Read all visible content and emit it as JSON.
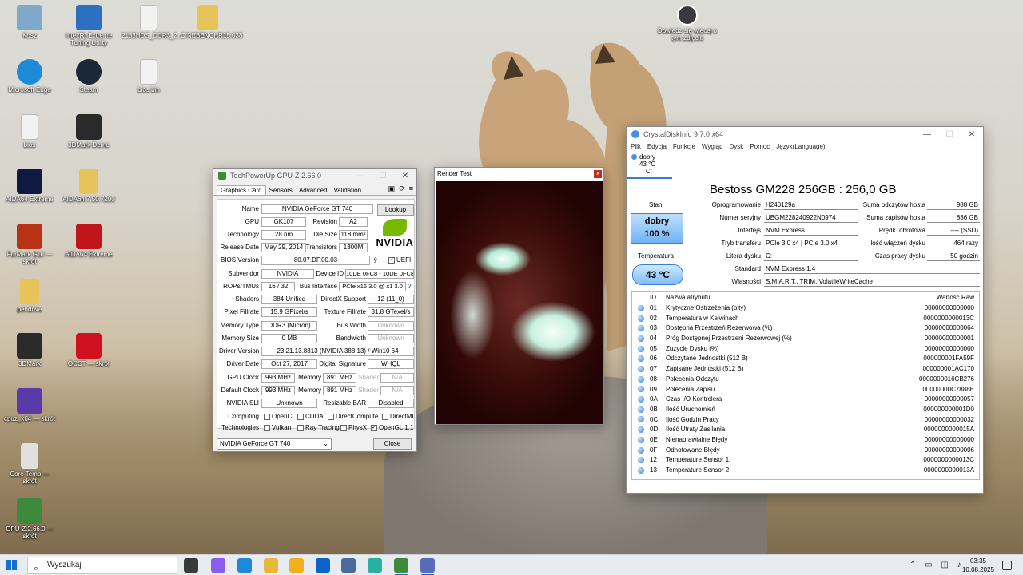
{
  "desktop": {
    "icons": [
      {
        "label": "Kosz",
        "color": "#7fa9c9"
      },
      {
        "label": "Intel(R) Extreme Tuning Utility",
        "color": "#2d6fc1"
      },
      {
        "label": "2133HDS_DDR3_2...",
        "color": "#f2f2f2"
      },
      {
        "label": "CINEBENCHR15.038",
        "color": "#e8c35a"
      },
      {
        "label": "Microsoft Edge",
        "color": "#1c8ad6"
      },
      {
        "label": "Steam",
        "color": "#1b2838"
      },
      {
        "label": "bios.bin",
        "color": "#f2f2f2"
      },
      {
        "label": "bios",
        "color": "#f2f2f2"
      },
      {
        "label": "3DMark Demo",
        "color": "#2a2a2a"
      },
      {
        "label": "AIDA64 Extreme",
        "color": "#101a40"
      },
      {
        "label": "AIDA64.7.50.7200",
        "color": "#e8c35a"
      },
      {
        "label": "FurMark GUI — skrót",
        "color": "#b83216"
      },
      {
        "label": "AIDA64 Extreme",
        "color": "#c0151b"
      },
      {
        "label": "pendrive",
        "color": "#e8c35a"
      },
      {
        "label": "3DMark",
        "color": "#2a2a2a"
      },
      {
        "label": "OCCT — skrót",
        "color": "#d01020"
      },
      {
        "label": "cpuz_x64 — skrót",
        "color": "#5a3aa8"
      },
      {
        "label": "Core Temp — skrót",
        "color": "#e0e0e0"
      },
      {
        "label": "GPU-Z.2.66.0 — skrót",
        "color": "#3d8a3d"
      }
    ],
    "spotlight_label": "Dowiedz się więcej o tym zdjęciu"
  },
  "gpuz": {
    "title": "TechPowerUp GPU-Z 2.66.0",
    "tabs": [
      "Graphics Card",
      "Sensors",
      "Advanced",
      "Validation"
    ],
    "tool_icons": [
      "camera-icon",
      "refresh-icon",
      "menu-icon"
    ],
    "lookup_label": "Lookup",
    "brand_word": "NVIDIA",
    "labels": {
      "name": "Name",
      "gpu": "GPU",
      "revision": "Revision",
      "technology": "Technology",
      "die_size": "Die Size",
      "release_date": "Release Date",
      "transistors": "Transistors",
      "bios_version": "BIOS Version",
      "uefi": "UEFI",
      "subvendor": "Subvendor",
      "device_id": "Device ID",
      "rops": "ROPs/TMUs",
      "bus_interface": "Bus Interface",
      "shaders": "Shaders",
      "directx": "DirectX Support",
      "pixel_fillrate": "Pixel Fillrate",
      "texture_fillrate": "Texture Fillrate",
      "memory_type": "Memory Type",
      "bus_width": "Bus Width",
      "memory_size": "Memory Size",
      "bandwidth": "Bandwidth",
      "driver_version": "Driver Version",
      "driver_date": "Driver Date",
      "digital_signature": "Digital Signature",
      "gpu_clock": "GPU Clock",
      "memory": "Memory",
      "shader": "Shader",
      "default_clock": "Default Clock",
      "sli": "NVIDIA SLI",
      "resizable_bar": "Resizable BAR",
      "computing": "Computing",
      "technologies": "Technologies"
    },
    "values": {
      "name": "NVIDIA GeForce GT 740",
      "gpu": "GK107",
      "revision": "A2",
      "technology": "28 nm",
      "die_size": "118 mm²",
      "release_date": "May 29, 2014",
      "transistors": "1300M",
      "bios_version": "80.07.DF.00.03",
      "subvendor": "NVIDIA",
      "device_id": "10DE 0FC8 - 10DE 0FC8",
      "rops": "16 / 32",
      "bus_interface": "PCIe x16 3.0 @ x1 3.0",
      "shaders": "384 Unified",
      "directx": "12 (11_0)",
      "pixel_fillrate": "15.9 GPixel/s",
      "texture_fillrate": "31.8 GTexel/s",
      "memory_type": "DDR3 (Micron)",
      "bus_width": "Unknown",
      "memory_size": "0 MB",
      "bandwidth": "Unknown",
      "driver_version": "23.21.13.8813 (NVIDIA 388.13) / Win10 64",
      "driver_date": "Oct 27, 2017",
      "digital_signature": "WHQL",
      "gpu_clock": "993 MHz",
      "gpu_memory": "891 MHz",
      "gpu_shader": "N/A",
      "default_clock": "993 MHz",
      "default_memory": "891 MHz",
      "default_shader": "N/A",
      "sli": "Unknown",
      "resizable_bar": "Disabled"
    },
    "computing": [
      "OpenCL",
      "CUDA",
      "DirectCompute",
      "DirectML"
    ],
    "technologies": [
      "Vulkan",
      "Ray Tracing",
      "PhysX",
      "OpenGL 1.1"
    ],
    "opengl_checked_mark": "✓",
    "help_mark": "?",
    "selected_card": "NVIDIA GeForce GT 740",
    "close_label": "Close"
  },
  "render_test": {
    "title": "Render Test",
    "close_mark": "x"
  },
  "crystaldisk": {
    "title": "CrystalDiskInfo 9.7.0 x64",
    "menu": [
      "Plik",
      "Edycja",
      "Funkcje",
      "Wygląd",
      "Dysk",
      "Pomoc",
      "Język(Language)"
    ],
    "drive_tab": {
      "status": "dobry",
      "temp": "43 °C",
      "letter": "C:"
    },
    "model": "Bestoss GM228 256GB : 256,0 GB",
    "stan_label": "Stan",
    "status": "dobry",
    "status_pct": "100 %",
    "temp_label": "Temperatura",
    "temperature": "43 °C",
    "fields": {
      "firmware_label": "Oprogramowanie",
      "firmware": "H240129a",
      "serial_label": "Numer seryjny",
      "serial": "UBGM228240922N0974",
      "interface_label": "Interfejs",
      "interface": "NVM Express",
      "transfer_label": "Tryb transferu",
      "transfer": "PCIe 3.0 x4 | PCIe 3.0 x4",
      "letter_label": "Litera dysku",
      "letter": "C:",
      "standard_label": "Standard",
      "standard": "NVM Express 1.4",
      "features_label": "Własności",
      "features": "S.M.A.R.T., TRIM, VolatileWriteCache",
      "reads_label": "Suma odczytów hosta",
      "reads": "988 GB",
      "writes_label": "Suma zapisów hosta",
      "writes": "836 GB",
      "rpm_label": "Prędk. obrotowa",
      "rpm": "---- (SSD)",
      "power_on_count_label": "Ilość włączeń dysku",
      "power_on_count": "464 razy",
      "power_on_hours_label": "Czas pracy dysku",
      "power_on_hours": "50 godzin"
    },
    "smart_headers": {
      "id": "ID",
      "name": "Nazwa atrybutu",
      "raw": "Wartość Raw"
    },
    "smart_rows": [
      {
        "id": "01",
        "name": "Krytyczne Ostrzeżenia (bity)",
        "raw": "00000000000000"
      },
      {
        "id": "02",
        "name": "Temperatura w Kelwinach",
        "raw": "0000000000013C"
      },
      {
        "id": "03",
        "name": "Dostępna Przestrzeń Rezerwowa (%)",
        "raw": "00000000000064"
      },
      {
        "id": "04",
        "name": "Próg Dostępnej Przestrzeni Rezerwowej (%)",
        "raw": "00000000000001"
      },
      {
        "id": "05",
        "name": "Zużycie Dysku (%)",
        "raw": "00000000000000"
      },
      {
        "id": "06",
        "name": "Odczytane Jednostki (512 B)",
        "raw": "000000001FA59F"
      },
      {
        "id": "07",
        "name": "Zapisane Jednostki (512 B)",
        "raw": "000000001AC170"
      },
      {
        "id": "08",
        "name": "Polecenia Odczytu",
        "raw": "0000000016CB276"
      },
      {
        "id": "09",
        "name": "Polecenia Zapisu",
        "raw": "00000000C7888E"
      },
      {
        "id": "0A",
        "name": "Czas I/O Kontrolera",
        "raw": "00000000000057"
      },
      {
        "id": "0B",
        "name": "Ilość Uruchomień",
        "raw": "000000000001D0"
      },
      {
        "id": "0C",
        "name": "Ilość Godzin Pracy",
        "raw": "00000000000032"
      },
      {
        "id": "0D",
        "name": "Ilość Utraty Zasilania",
        "raw": "0000000000015A"
      },
      {
        "id": "0E",
        "name": "Nienaprawialne Błędy",
        "raw": "00000000000000"
      },
      {
        "id": "0F",
        "name": "Odnotowane Błędy",
        "raw": "00000000000006"
      },
      {
        "id": "12",
        "name": "Temperature Sensor 1",
        "raw": "0000000000013C"
      },
      {
        "id": "13",
        "name": "Temperature Sensor 2",
        "raw": "0000000000013A"
      }
    ]
  },
  "taskbar": {
    "search_placeholder": "Wyszukaj",
    "apps": [
      {
        "name": "task-view-icon",
        "color": "#3a3a3a"
      },
      {
        "name": "copilot-icon",
        "color": "#8a5cf0"
      },
      {
        "name": "edge-icon",
        "color": "#1c8ad6"
      },
      {
        "name": "file-explorer-icon",
        "color": "#e8b83a"
      },
      {
        "name": "store-icon",
        "color": "#f2b01e"
      },
      {
        "name": "outlook-icon",
        "color": "#0a64c8"
      },
      {
        "name": "app-window-icon",
        "color": "#4a6a9a"
      },
      {
        "name": "location-icon",
        "color": "#2ab0a0"
      },
      {
        "name": "gpuz-icon",
        "color": "#3d8a3d"
      },
      {
        "name": "furmark-icon",
        "color": "#5a6ab8"
      }
    ],
    "time": "03:35",
    "date": "10.08.2025"
  }
}
